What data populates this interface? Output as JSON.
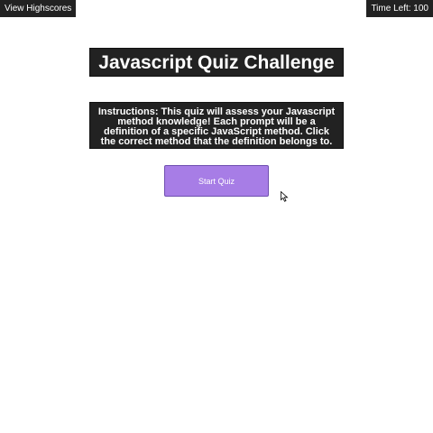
{
  "header": {
    "highscores_label": "View Highscores",
    "timer_label": "Time Left: 100"
  },
  "main": {
    "title": "Javascript Quiz Challenge",
    "instructions": "Instructions: This quiz will assess your Javascript method knowledge! Each prompt will be a definition of a specific JavaScript method. Click the correct method that the definition belongs to.",
    "start_label": "Start Quiz"
  },
  "colors": {
    "dark_panel": "#222222",
    "button": "#a77de6",
    "text_light": "#ffffff"
  },
  "icons": {
    "cursor": "mouse-pointer-icon"
  }
}
